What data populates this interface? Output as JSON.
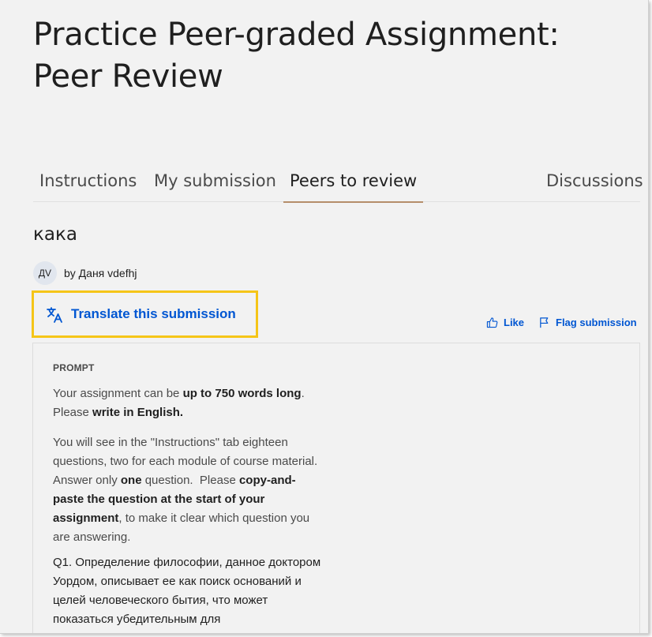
{
  "header": {
    "title": "Practice Peer-graded Assignment: Peer Review"
  },
  "tabs": [
    {
      "label": "Instructions"
    },
    {
      "label": "My submission"
    },
    {
      "label": "Peers to review"
    },
    {
      "label": "Discussions"
    }
  ],
  "active_tab": "Peers to review",
  "submission": {
    "title": "кака",
    "avatar_initials": "ДV",
    "author": "by Даня vdefhj"
  },
  "actions": {
    "translate_label": "Translate this submission",
    "like_label": "Like",
    "flag_label": "Flag submission"
  },
  "prompt": {
    "label": "PROMPT",
    "p1_a": "Your assignment can be ",
    "p1_b": "up to 750 words long",
    "p1_c": ". Please ",
    "p1_d": "write in English.",
    "p2_a": "You will see in the \"Instructions\" tab eighteen questions, two for each module of course material.    Answer only ",
    "p2_b": "one",
    "p2_c": " question.  Please ",
    "p2_d": "copy-and-paste the question at the start of your assignment",
    "p2_e": ", to make it clear which question you are answering.",
    "p3": "Q1. Определение философии, данное доктором Уордом, описывает ее как поиск оснований и целей человеческого бытия, что может показаться убедительным для"
  },
  "colors": {
    "link": "#0056d2",
    "highlight_border": "#f5c518",
    "active_tab_underline": "#b58e6a",
    "background": "#f2f2f2"
  },
  "icons": {
    "translate": "translate-icon",
    "like": "thumbs-up-icon",
    "flag": "flag-icon"
  }
}
